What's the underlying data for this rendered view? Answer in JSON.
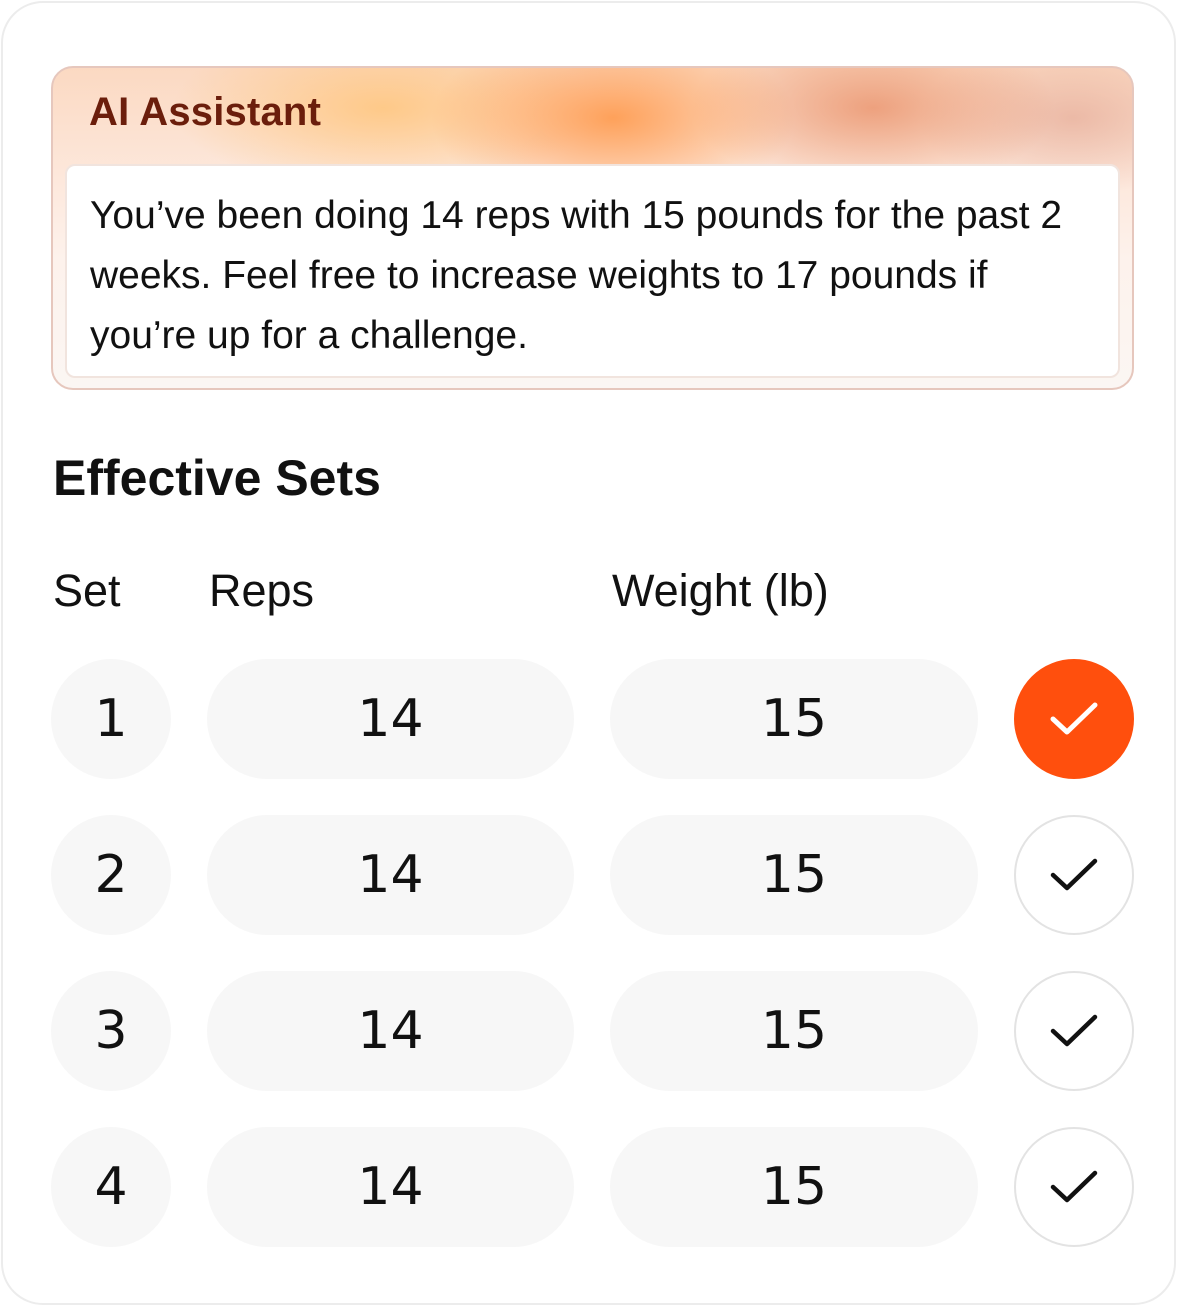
{
  "ai_assistant": {
    "title": "AI Assistant",
    "message": "You’ve been doing 14 reps with 15 pounds for the past 2 weeks. Feel free to increase weights to 17 pounds if you’re up for a challenge."
  },
  "effective_sets": {
    "title": "Effective Sets",
    "headers": {
      "set": "Set",
      "reps": "Reps",
      "weight": "Weight (lb)"
    },
    "rows": [
      {
        "set": "1",
        "reps": "14",
        "weight": "15",
        "completed": true
      },
      {
        "set": "2",
        "reps": "14",
        "weight": "15",
        "completed": false
      },
      {
        "set": "3",
        "reps": "14",
        "weight": "15",
        "completed": false
      },
      {
        "set": "4",
        "reps": "14",
        "weight": "15",
        "completed": false
      }
    ]
  },
  "colors": {
    "accent": "#ff4f0d",
    "title_brown": "#6b1e0c",
    "pill_bg": "#f7f7f7"
  },
  "icons": {
    "check": "checkmark-icon"
  }
}
